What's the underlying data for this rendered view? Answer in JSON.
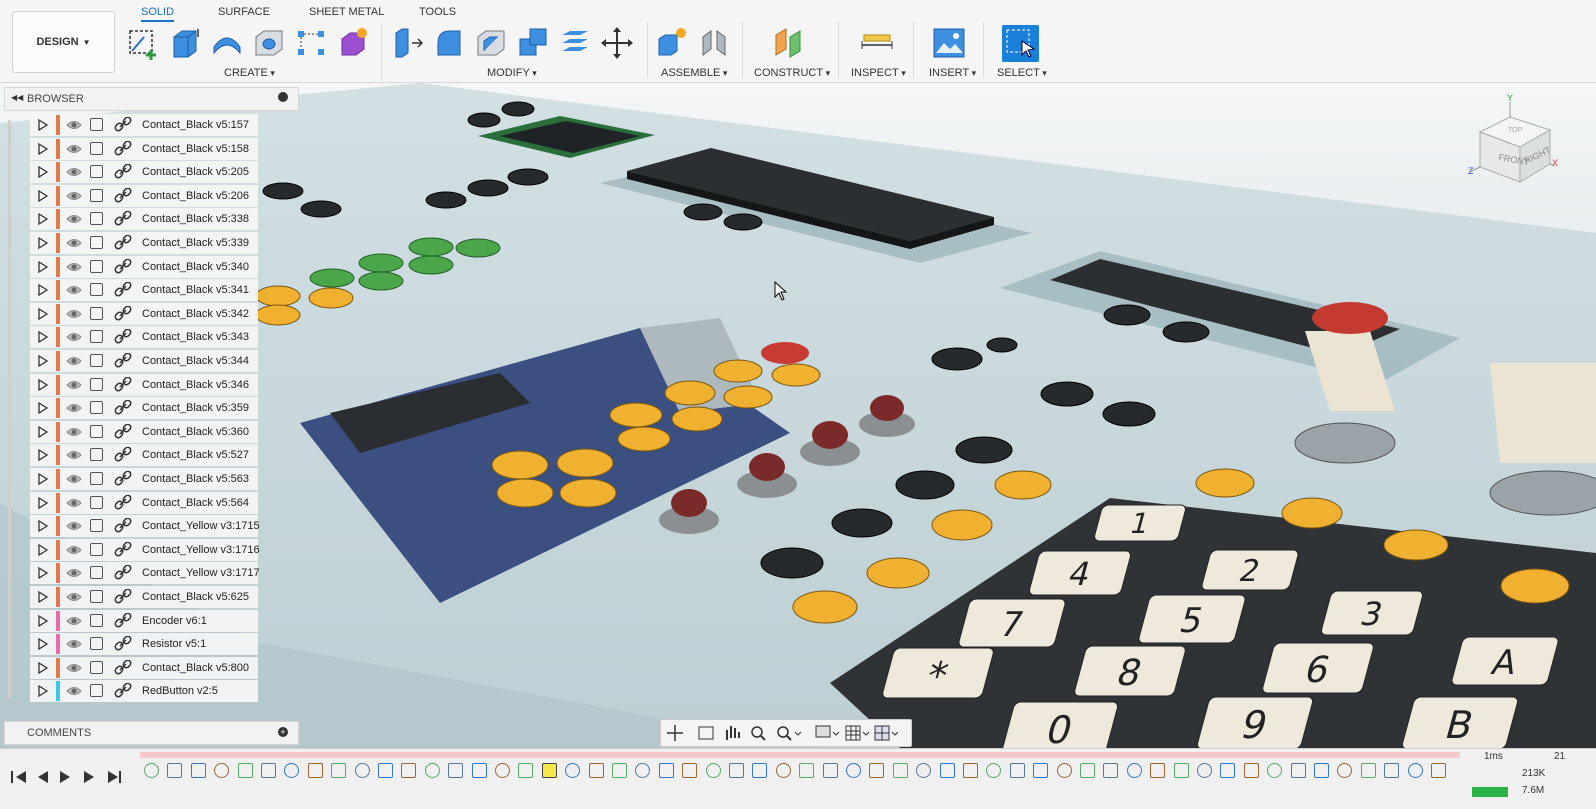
{
  "toolbar": {
    "workspace": "DESIGN",
    "tabs": [
      {
        "label": "SOLID",
        "active": true
      },
      {
        "label": "SURFACE",
        "active": false
      },
      {
        "label": "SHEET METAL",
        "active": false
      },
      {
        "label": "TOOLS",
        "active": false
      }
    ],
    "groups": {
      "create": "CREATE",
      "modify": "MODIFY",
      "assemble": "ASSEMBLE",
      "construct": "CONSTRUCT",
      "inspect": "INSPECT",
      "insert": "INSERT",
      "select": "SELECT"
    }
  },
  "browser": {
    "title": "BROWSER",
    "items": [
      {
        "label": "Contact_Black v5:157",
        "color": "#e07a4a",
        "icon": "link"
      },
      {
        "label": "Contact_Black v5:158",
        "color": "#e07a4a",
        "icon": "link"
      },
      {
        "label": "Contact_Black v5:205",
        "color": "#e07a4a",
        "icon": "link"
      },
      {
        "label": "Contact_Black v5:206",
        "color": "#e07a4a",
        "icon": "link"
      },
      {
        "label": "Contact_Black v5:338",
        "color": "#e07a4a",
        "icon": "link"
      },
      {
        "label": "Contact_Black v5:339",
        "color": "#e07a4a",
        "icon": "link"
      },
      {
        "label": "Contact_Black v5:340",
        "color": "#e07a4a",
        "icon": "link"
      },
      {
        "label": "Contact_Black v5:341",
        "color": "#e07a4a",
        "icon": "link"
      },
      {
        "label": "Contact_Black v5:342",
        "color": "#e07a4a",
        "icon": "link"
      },
      {
        "label": "Contact_Black v5:343",
        "color": "#e07a4a",
        "icon": "link"
      },
      {
        "label": "Contact_Black v5:344",
        "color": "#e07a4a",
        "icon": "link"
      },
      {
        "label": "Contact_Black v5:346",
        "color": "#e07a4a",
        "icon": "link"
      },
      {
        "label": "Contact_Black v5:359",
        "color": "#e07a4a",
        "icon": "link"
      },
      {
        "label": "Contact_Black v5:360",
        "color": "#e07a4a",
        "icon": "link"
      },
      {
        "label": "Contact_Black v5:527",
        "color": "#e07a4a",
        "icon": "link"
      },
      {
        "label": "Contact_Black v5:563",
        "color": "#e07a4a",
        "icon": "link"
      },
      {
        "label": "Contact_Black v5:564",
        "color": "#e07a4a",
        "icon": "link"
      },
      {
        "label": "Contact_Yellow v3:1715",
        "color": "#e07a4a",
        "icon": "link"
      },
      {
        "label": "Contact_Yellow v3:1716",
        "color": "#e07a4a",
        "icon": "link"
      },
      {
        "label": "Contact_Yellow v3:1717",
        "color": "#e07a4a",
        "icon": "link"
      },
      {
        "label": "Contact_Black v5:625",
        "color": "#e07a4a",
        "icon": "link"
      },
      {
        "label": "Encoder v6:1",
        "color": "#e86aa8",
        "icon": "link"
      },
      {
        "label": "Resistor v5:1",
        "color": "#e86aa8",
        "icon": "link"
      },
      {
        "label": "Contact_Black v5:800",
        "color": "#e07a4a",
        "icon": "link"
      },
      {
        "label": "RedButton v2:5",
        "color": "#3cc8e6",
        "icon": "link"
      }
    ]
  },
  "comments": {
    "title": "COMMENTS"
  },
  "viewcube": {
    "front": "FRONT",
    "right": "RIGHT",
    "top": "TOP",
    "x": "X",
    "y": "Y",
    "z": "Z"
  },
  "keypad": {
    "keys": [
      "1",
      "2",
      "3",
      "A",
      "4",
      "5",
      "6",
      "B",
      "7",
      "8",
      "9",
      "*",
      "0"
    ]
  },
  "perf": {
    "a": "1ms",
    "b": "21",
    "c": "213K",
    "d": "7.6M"
  }
}
